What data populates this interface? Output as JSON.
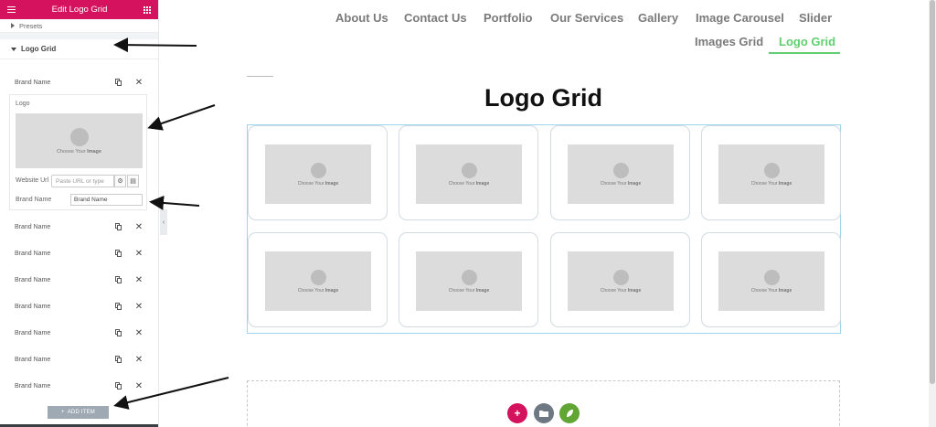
{
  "panel": {
    "title": "Edit Logo Grid",
    "presets_label": "Presets",
    "section_label": "Logo Grid",
    "item_label": "Brand Name",
    "open_item": {
      "logo_label": "Logo",
      "choose_text": "Choose Your",
      "choose_bold": "Image",
      "url_label": "Website Url",
      "url_placeholder": "Paste URL or type",
      "name_label": "Brand Name",
      "name_value": "Brand Name"
    },
    "add_item_label": "ADD ITEM"
  },
  "nav": {
    "items": [
      "About Us",
      "Contact Us",
      "Portfolio",
      "Our Services",
      "Gallery",
      "Image Carousel",
      "Slider",
      "Images Grid",
      "Logo Grid"
    ],
    "active": "Logo Grid",
    "active_color": "#61ce70"
  },
  "preview": {
    "title": "Logo Grid",
    "choose_text": "Choose Your",
    "choose_bold": "Image"
  },
  "colors": {
    "brand": "#d5125d",
    "add_circle": "#d5125d",
    "folder_circle": "#6d7882",
    "leaf_circle": "#61a534"
  },
  "icons": {
    "plus": "+",
    "collapse": "‹",
    "close": "✕"
  }
}
